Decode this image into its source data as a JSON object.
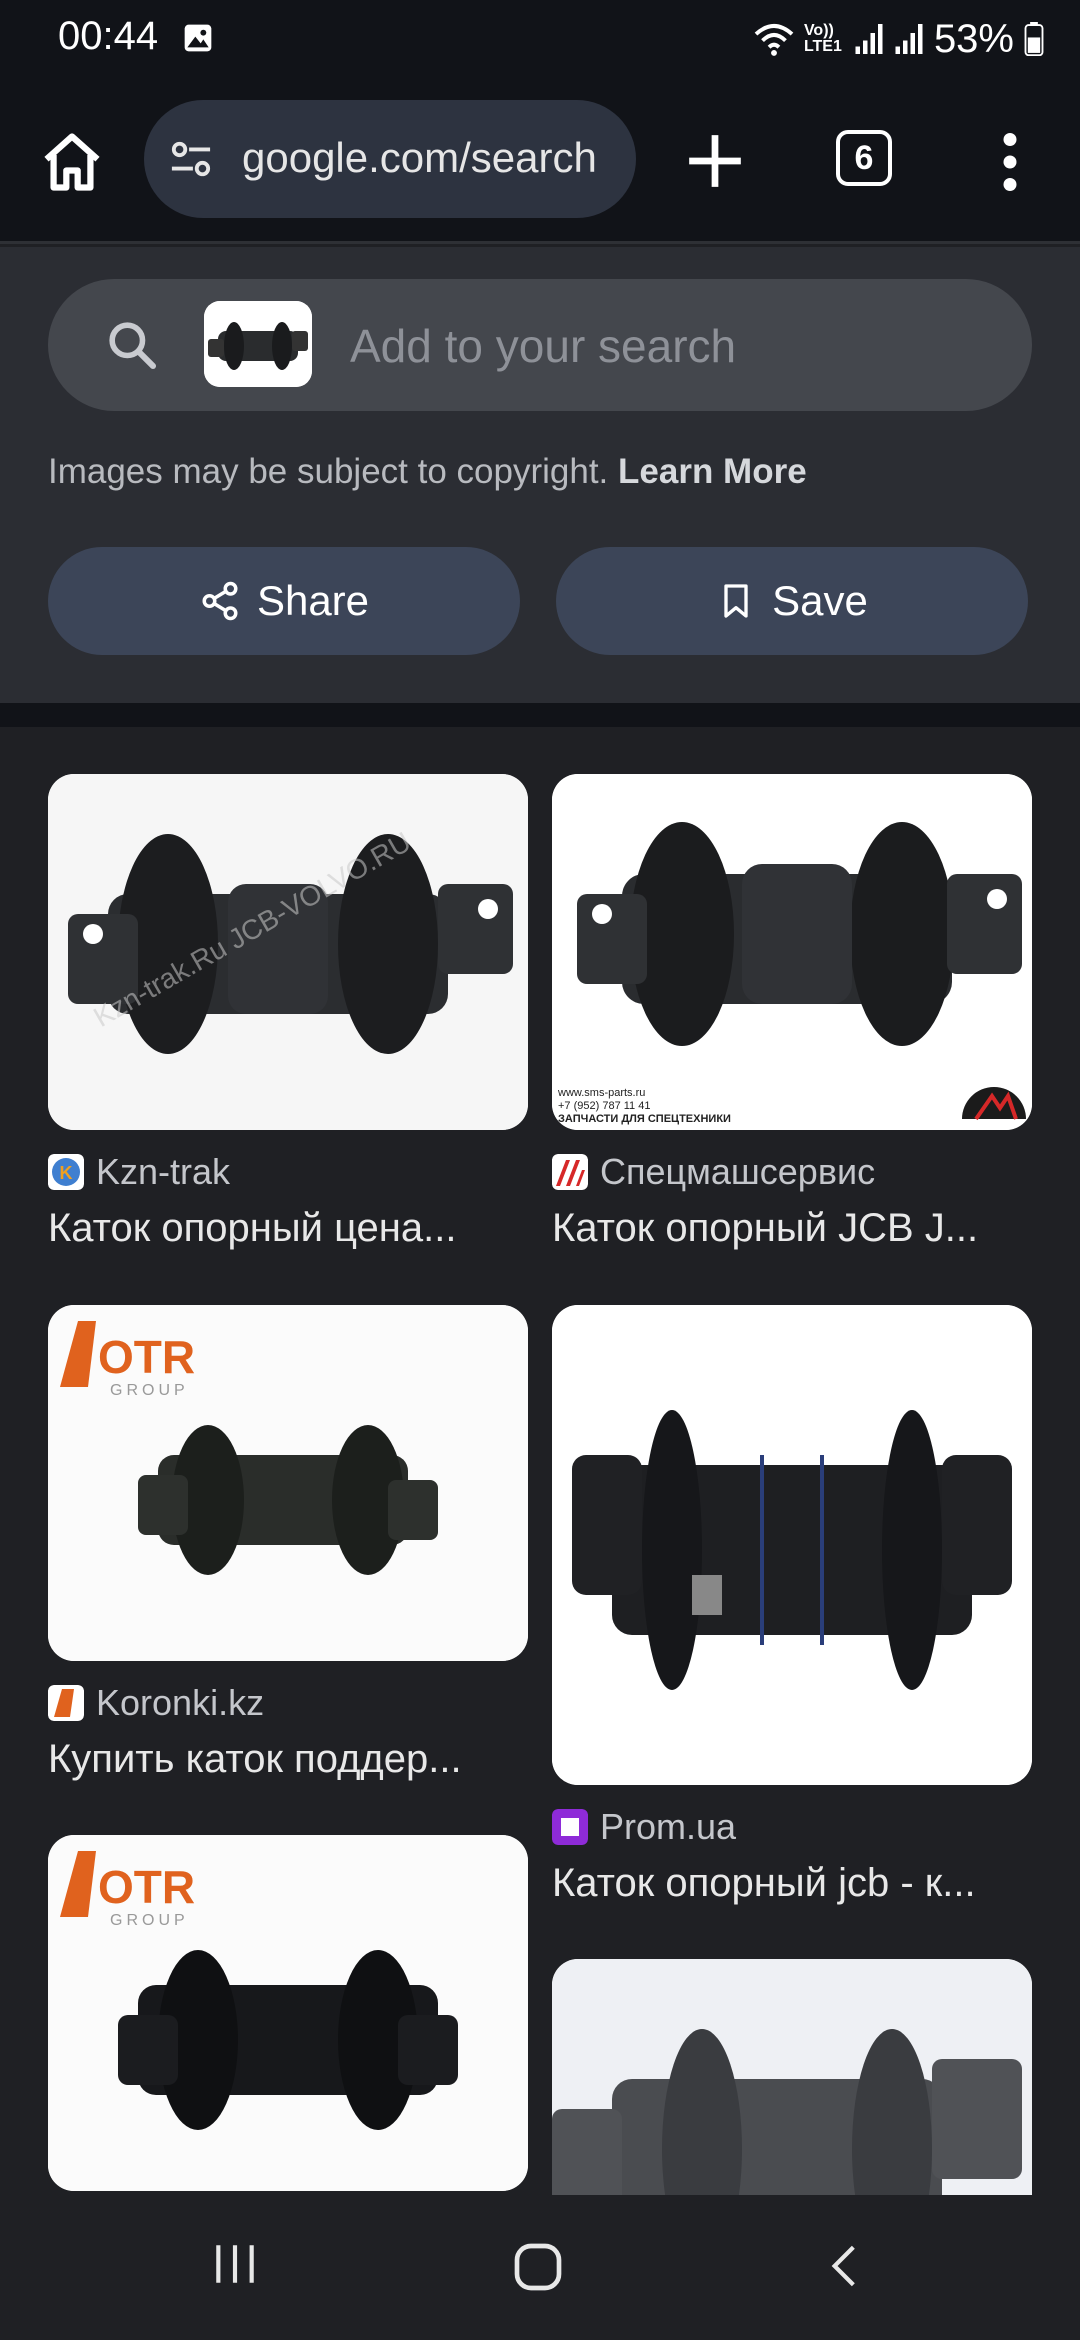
{
  "status": {
    "time": "00:44",
    "network": "Vo)) LTE1",
    "battery": "53%"
  },
  "browser": {
    "url": "google.com/search",
    "tab_count": "6"
  },
  "search": {
    "placeholder": "Add to your search"
  },
  "copyright": {
    "text": "Images may be subject to copyright.",
    "link": "Learn More"
  },
  "actions": {
    "share": "Share",
    "save": "Save"
  },
  "results": [
    {
      "source": "Kzn-trak",
      "title": "Каток опорный цена...",
      "watermark": "Kzn-trak.Ru JCB-VOLVO.RU"
    },
    {
      "source": "Спецмашсервис",
      "title": "Каток опорный JCB J...",
      "caption_line1": "www.sms-parts.ru",
      "caption_line2": "+7 (952) 787 11 41",
      "caption_line3": "ЗАПЧАСТИ ДЛЯ СПЕЦТЕХНИКИ"
    },
    {
      "source": "Koronki.kz",
      "title": "Купить каток поддер...",
      "logo": "OTR",
      "logo_sub": "GROUP"
    },
    {
      "source": "Prom.ua",
      "title": "Каток опорный jcb - к..."
    },
    {
      "logo": "OTR",
      "logo_sub": "GROUP"
    }
  ],
  "colors": {
    "chrome_bg": "#111318",
    "panel_bg": "#2b2d33",
    "button_bg": "#3c4558",
    "page_bg": "#1f2024"
  }
}
